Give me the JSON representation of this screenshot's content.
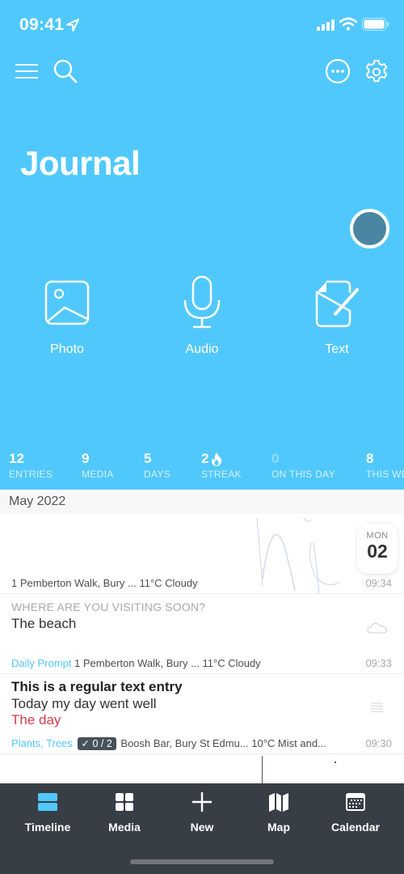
{
  "status_bar": {
    "time": "09:41"
  },
  "header": {
    "title": "Journal",
    "accent_color": "#51c8fc",
    "quick_actions": [
      {
        "label": "Photo",
        "icon": "photo-icon"
      },
      {
        "label": "Audio",
        "icon": "microphone-icon"
      },
      {
        "label": "Text",
        "icon": "edit-document-icon"
      }
    ],
    "stats": [
      {
        "value": "12",
        "label": "ENTRIES"
      },
      {
        "value": "9",
        "label": "MEDIA"
      },
      {
        "value": "5",
        "label": "DAYS"
      },
      {
        "value": "2",
        "label": "STREAK",
        "icon": "flame-icon"
      },
      {
        "value": "0",
        "label": "ON THIS DAY"
      },
      {
        "value": "8",
        "label": "THIS WEEK"
      }
    ]
  },
  "timeline": {
    "month": "May 2022",
    "entries": [
      {
        "type": "drawing",
        "day_of_week": "MON",
        "day": "02",
        "meta": "1 Pemberton Walk, Bury ... 11°C Cloudy",
        "time": "09:34"
      },
      {
        "type": "prompt",
        "prompt": "WHERE ARE YOU VISITING SOON?",
        "body": "The beach",
        "tag": "Daily Prompt",
        "meta": "1 Pemberton Walk, Bury ... 11°C Cloudy",
        "time": "09:33"
      },
      {
        "type": "text",
        "title": "This is a regular text entry",
        "line1": "Today my day went well",
        "line2": "The day",
        "tags": "Plants, Trees",
        "checklist": "✓ 0 / 2",
        "meta": "Boosh Bar, Bury St Edmu... 10°C Mist and...",
        "time": "09:30"
      }
    ]
  },
  "tabbar": {
    "tabs": [
      {
        "label": "Timeline",
        "active": true
      },
      {
        "label": "Media"
      },
      {
        "label": "New"
      },
      {
        "label": "Map"
      },
      {
        "label": "Calendar"
      }
    ]
  }
}
